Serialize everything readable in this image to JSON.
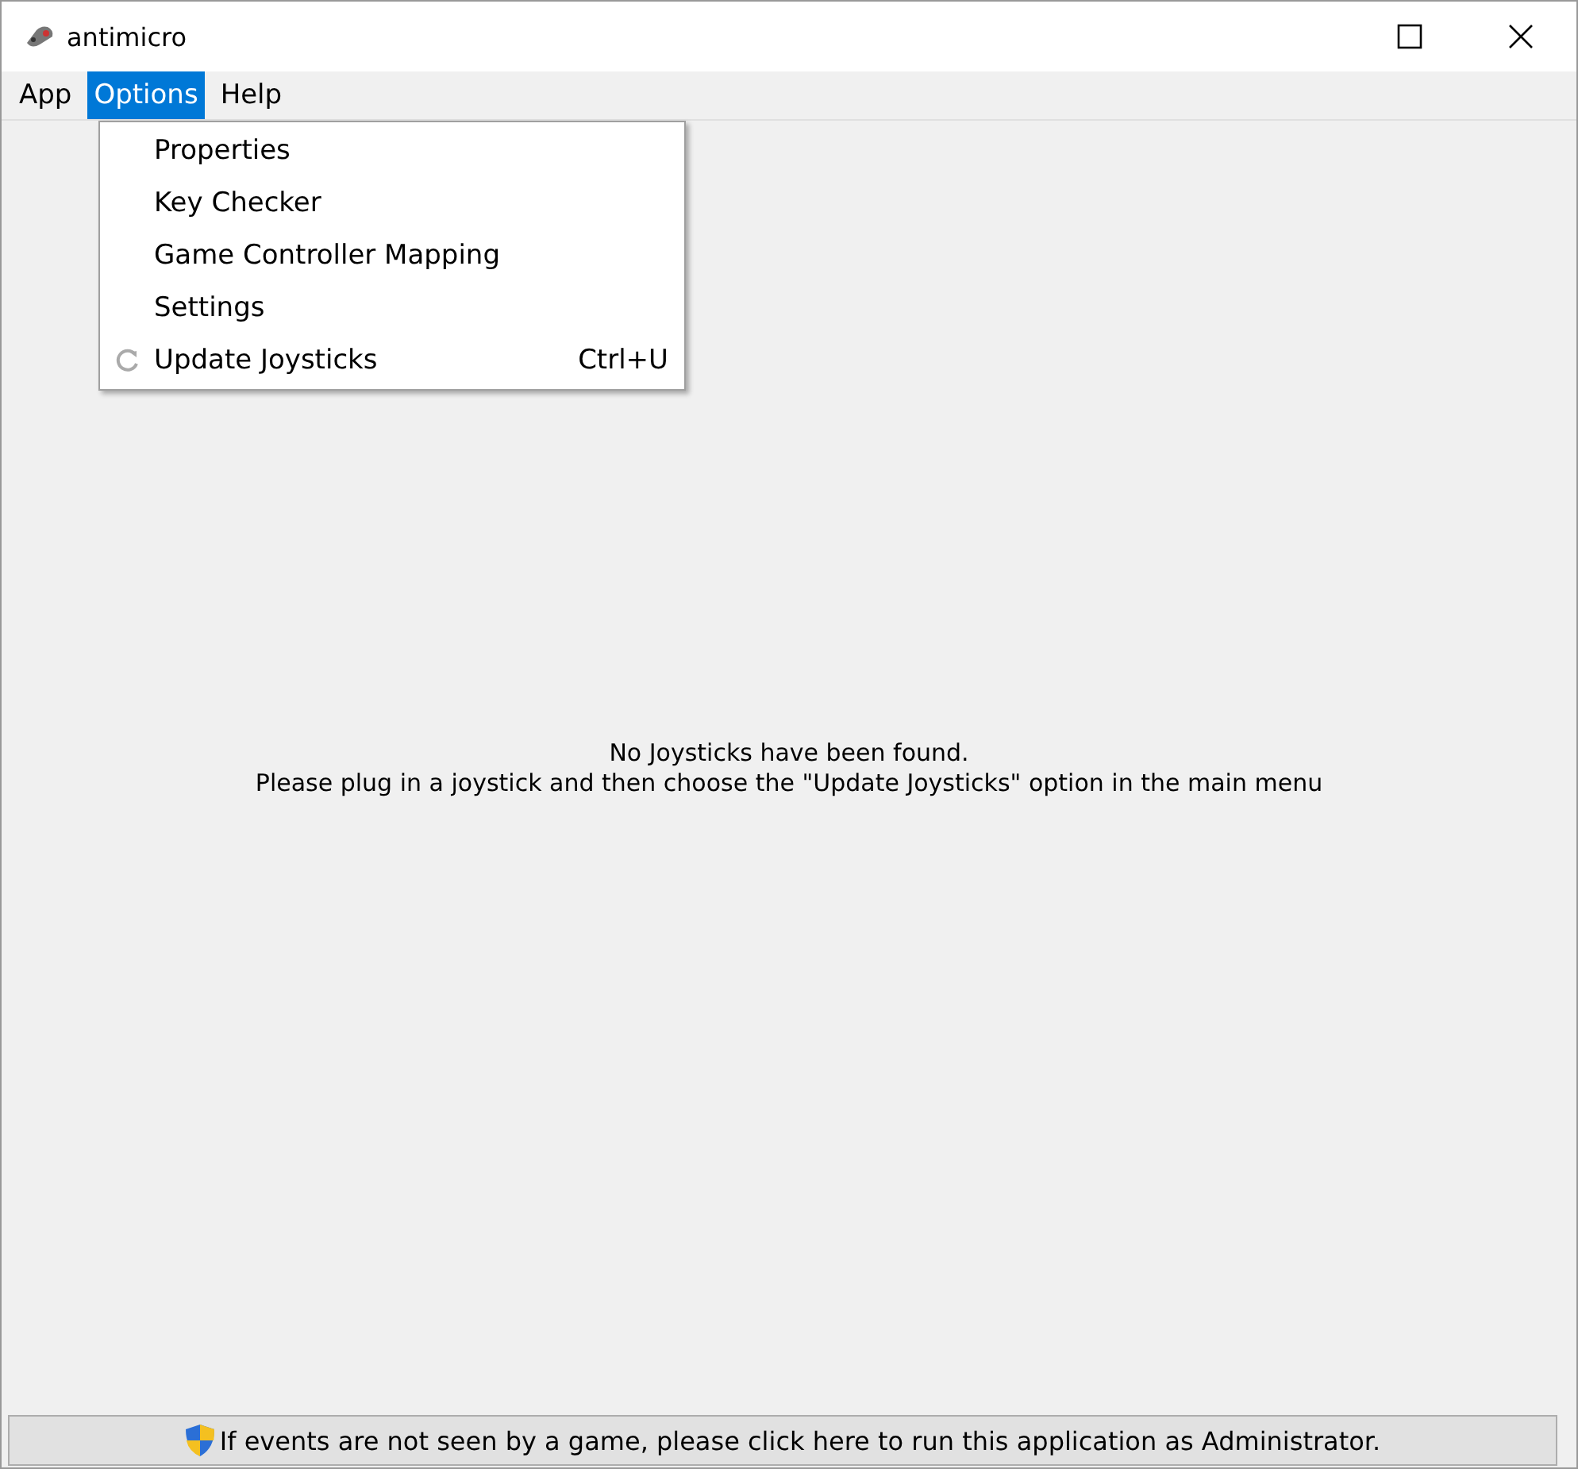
{
  "window": {
    "title": "antimicro"
  },
  "menubar": [
    {
      "label": "App",
      "selected": false
    },
    {
      "label": "Options",
      "selected": true
    },
    {
      "label": "Help",
      "selected": false
    }
  ],
  "menu": [
    {
      "label": "Properties",
      "kind": "plain"
    },
    {
      "label": "Key Checker",
      "kind": "plain"
    },
    {
      "label": "Game Controller Mapping",
      "kind": "plain"
    },
    {
      "label": "Settings",
      "kind": "plain"
    },
    {
      "label": "Update Joysticks",
      "kind": "refresh",
      "shortcut": "Ctrl+U"
    }
  ],
  "message": [
    "No Joysticks have been found.",
    "Please plug in a joystick and then choose the \"Update Joysticks\" option in the main menu"
  ],
  "admin_button": "If events are not seen by a game, please click here to run this application as Administrator."
}
